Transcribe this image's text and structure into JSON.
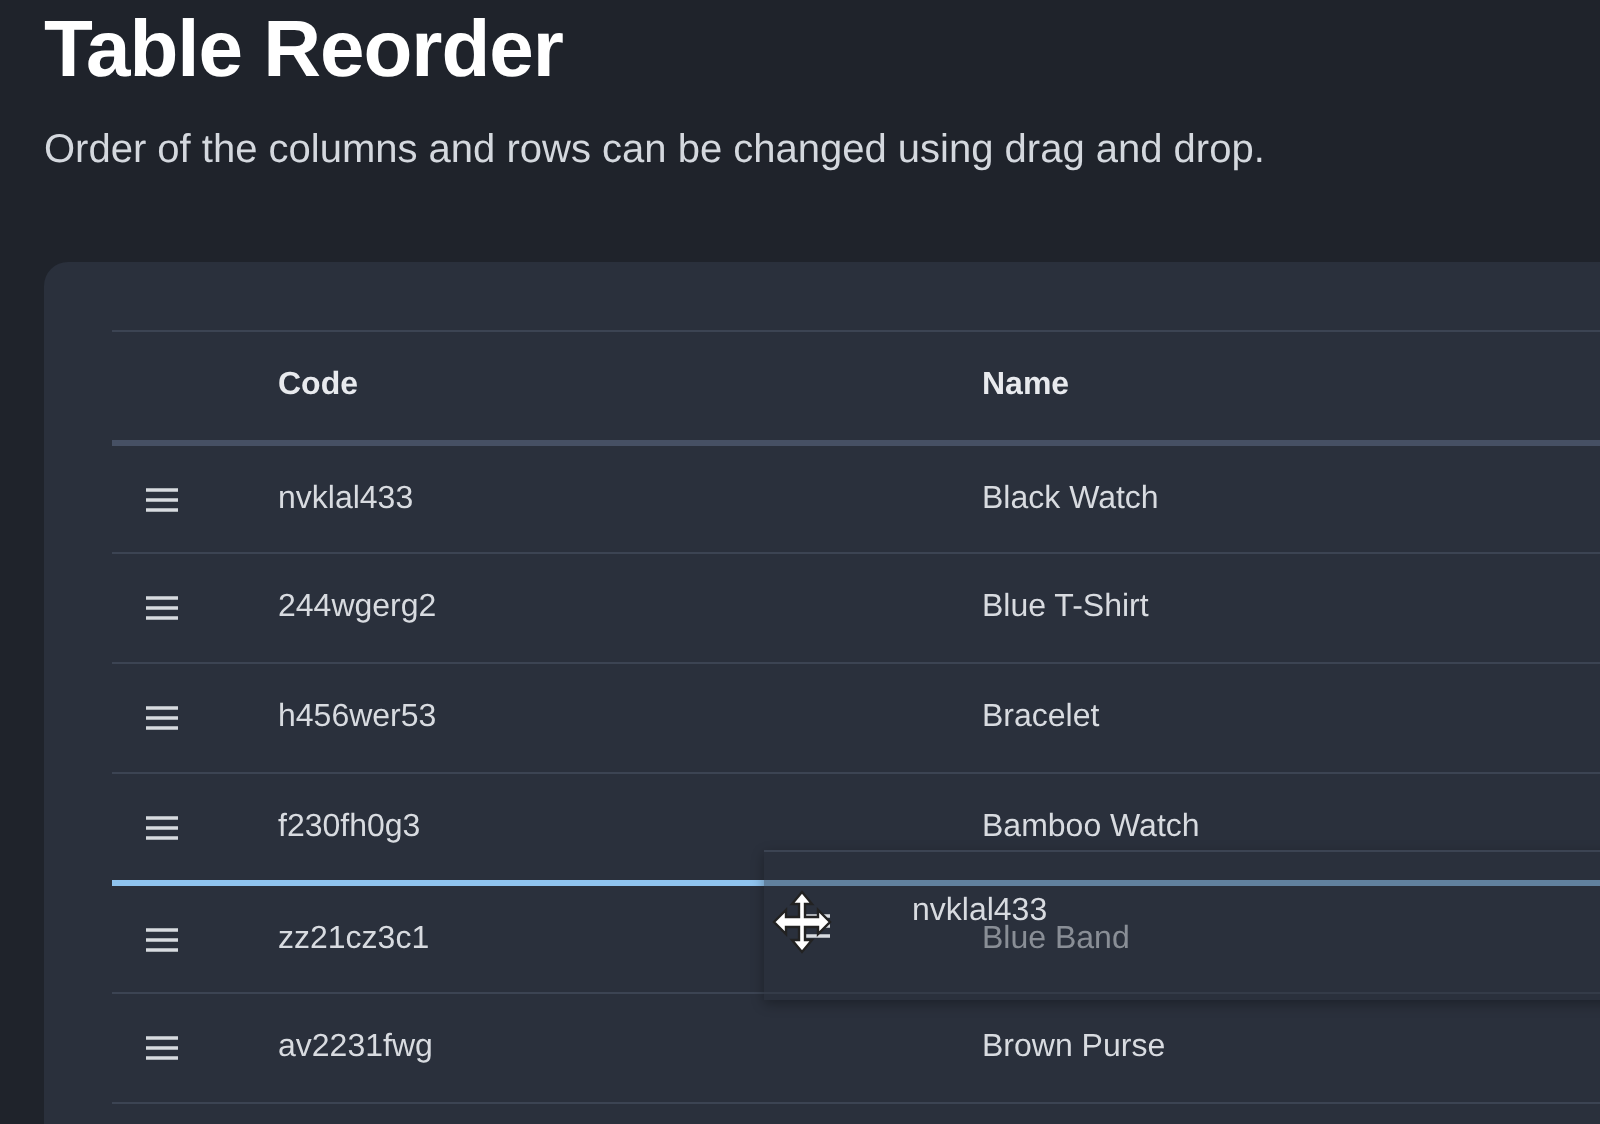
{
  "title": "Table Reorder",
  "subtitle": "Order of the columns and rows can be changed using drag and drop.",
  "table": {
    "columns": [
      "Code",
      "Name"
    ],
    "rows": [
      {
        "code": "nvklal433",
        "name": "Black Watch",
        "drop_below": false
      },
      {
        "code": "244wgerg2",
        "name": "Blue T-Shirt",
        "drop_below": false
      },
      {
        "code": "h456wer53",
        "name": "Bracelet",
        "drop_below": false
      },
      {
        "code": "f230fh0g3",
        "name": "Bamboo Watch",
        "drop_below": true
      },
      {
        "code": "zz21cz3c1",
        "name": "Blue Band",
        "drop_below": false
      },
      {
        "code": "av2231fwg",
        "name": "Brown Purse",
        "drop_below": false
      }
    ]
  },
  "drag_preview": {
    "code": "nvklal433"
  }
}
